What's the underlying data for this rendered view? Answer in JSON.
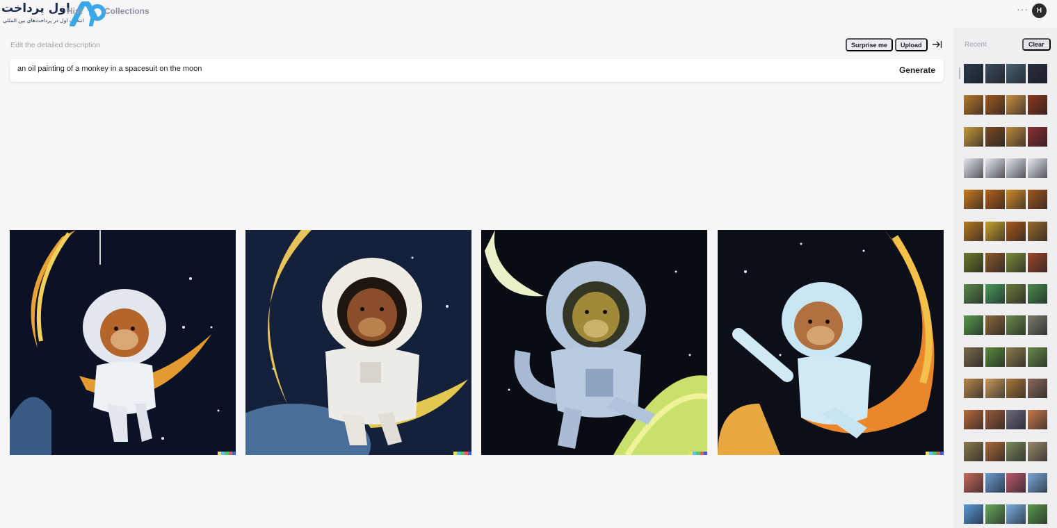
{
  "logo": {
    "title": "اول پرداخت",
    "tagline": "انتخاب اول در پرداخت‌های بین المللی"
  },
  "nav": {
    "history": "Hist",
    "collections": "Collections"
  },
  "header": {
    "more": "···",
    "avatar_initial": "H"
  },
  "prompt": {
    "label": "Edit the detailed description",
    "value": "an oil painting of a monkey in a spacesuit on the moon",
    "surprise_label": "Surprise me",
    "upload_label": "Upload",
    "generate_label": "Generate"
  },
  "results": [
    {
      "style": "white spacesuit monkey hanging on crescent moon"
    },
    {
      "style": "chimp astronaut sitting on crescent moon above earth"
    },
    {
      "style": "blue spacesuit monkey walking on green moon"
    },
    {
      "style": "light blue spacesuit monkey waving on orange crescent"
    }
  ],
  "signature_colors": [
    "#f4e04d",
    "#5ec2f0",
    "#52c274",
    "#ef5b5b",
    "#3a5ef0"
  ],
  "sidebar": {
    "recent_label": "Recent",
    "clear_label": "Clear",
    "rows": [
      {
        "colors": [
          "#2a3a4a",
          "#3a4a5a",
          "#4a6070",
          "#2a2e3e"
        ]
      },
      {
        "colors": [
          "#b8782a",
          "#a05a20",
          "#c89040",
          "#8a3a1a"
        ]
      },
      {
        "colors": [
          "#c49a3a",
          "#7a4a22",
          "#b8883a",
          "#8c3030"
        ]
      },
      {
        "colors": [
          "#e4e6ee",
          "#e6e8f0",
          "#e2e4ec",
          "#e8eaf2"
        ]
      },
      {
        "colors": [
          "#c87a1e",
          "#b4621a",
          "#d08a2a",
          "#a05820"
        ]
      },
      {
        "colors": [
          "#b8781e",
          "#c8a030",
          "#a85a1a",
          "#9a6a2a"
        ]
      },
      {
        "colors": [
          "#6a7a2a",
          "#8a5a2a",
          "#7a8a3a",
          "#9a4a2a"
        ]
      },
      {
        "colors": [
          "#5a8a4a",
          "#4a9a5a",
          "#6a7a3a",
          "#4a8a4a"
        ]
      },
      {
        "colors": [
          "#5a9a4a",
          "#8a6a3a",
          "#6a8a4a",
          "#7a7a6a"
        ]
      },
      {
        "colors": [
          "#7a6a4a",
          "#5a8a3a",
          "#8a7a4a",
          "#6a8a4a"
        ]
      },
      {
        "colors": [
          "#b8884a",
          "#c89a5a",
          "#a8783a",
          "#8a6a5a"
        ]
      },
      {
        "colors": [
          "#b86a3a",
          "#9a5a3a",
          "#6a6a7a",
          "#c87a4a"
        ]
      },
      {
        "colors": [
          "#8a7a4a",
          "#a86a3a",
          "#7a8a5a",
          "#9a8a6a"
        ]
      },
      {
        "colors": [
          "#c86a5a",
          "#6a9ad0",
          "#b85a6a",
          "#7aaad8"
        ]
      },
      {
        "colors": [
          "#5a9ad8",
          "#6aaa5a",
          "#7ab0e0",
          "#5a9a4a"
        ]
      }
    ]
  }
}
